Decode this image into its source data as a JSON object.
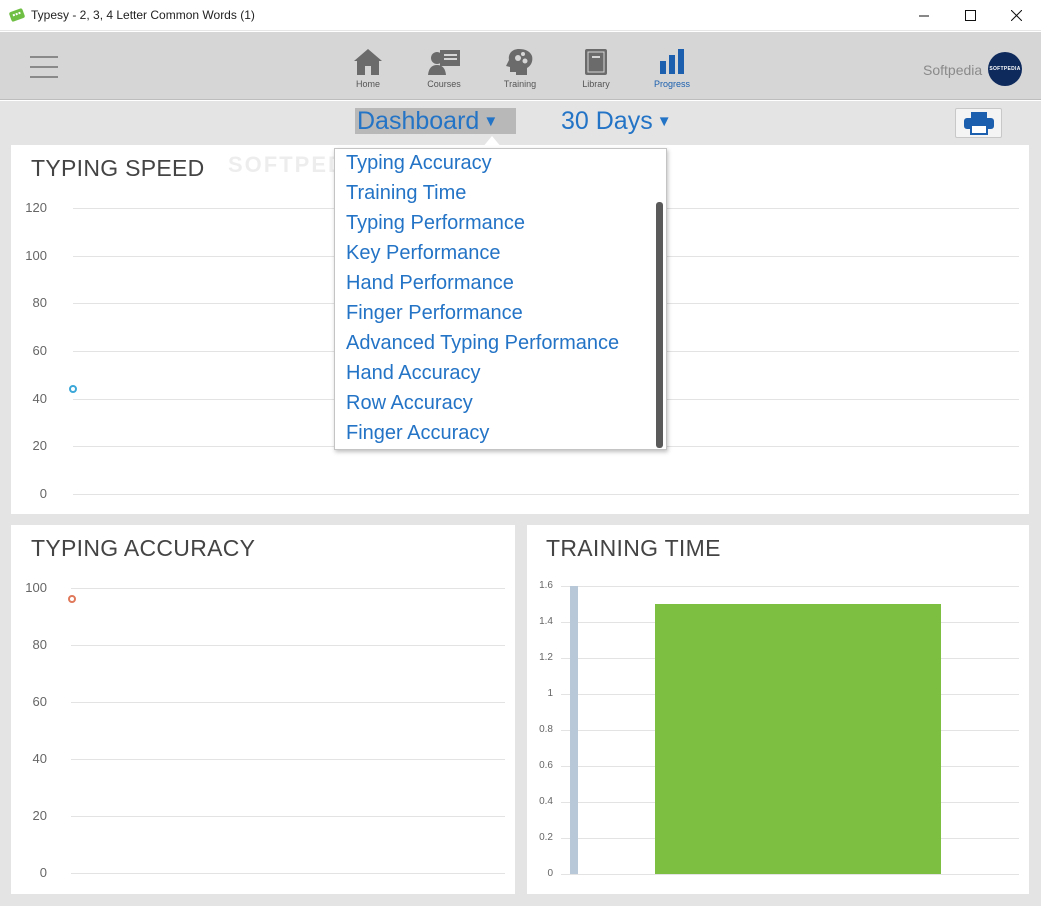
{
  "window": {
    "title": "Typesy - 2, 3, 4 Letter Common Words (1)"
  },
  "nav": {
    "items": [
      {
        "label": "Home",
        "icon": "home-icon"
      },
      {
        "label": "Courses",
        "icon": "courses-icon"
      },
      {
        "label": "Training",
        "icon": "training-icon"
      },
      {
        "label": "Library",
        "icon": "library-icon"
      },
      {
        "label": "Progress",
        "icon": "progress-icon"
      }
    ],
    "active": "Progress",
    "user_name": "Softpedia",
    "avatar_text": "SOFTPEDIA"
  },
  "toolbar": {
    "view_select": "Dashboard",
    "range_select": "30 Days"
  },
  "dropdown": {
    "items": [
      "Typing Accuracy",
      "Training Time",
      "Typing Performance",
      "Key Performance",
      "Hand Performance",
      "Finger Performance",
      "Advanced Typing Performance",
      "Hand Accuracy",
      "Row Accuracy",
      "Finger Accuracy"
    ]
  },
  "watermark": "SOFTPEDIA",
  "colors": {
    "accent": "#2373c6",
    "speed_point": "#3aa7d8",
    "accuracy_point": "#e0785a",
    "training_bar": "#7dbf41",
    "training_axis_bar": "#b8c8d8"
  },
  "chart_data": [
    {
      "type": "scatter",
      "title": "TYPING SPEED",
      "yticks": [
        "120",
        "100",
        "80",
        "60",
        "40",
        "20",
        "0"
      ],
      "ylim": [
        0,
        120
      ],
      "points": [
        {
          "x": 0,
          "y": 44
        }
      ]
    },
    {
      "type": "scatter",
      "title": "TYPING ACCURACY",
      "yticks": [
        "100",
        "80",
        "60",
        "40",
        "20",
        "0"
      ],
      "ylim": [
        0,
        100
      ],
      "points": [
        {
          "x": 0,
          "y": 96
        }
      ]
    },
    {
      "type": "bar",
      "title": "TRAINING TIME",
      "yticks": [
        "1.6",
        "1.4",
        "1.2",
        "1",
        "0.8",
        "0.6",
        "0.4",
        "0.2",
        "0"
      ],
      "ylim": [
        0,
        1.6
      ],
      "values": [
        1.5
      ]
    }
  ]
}
